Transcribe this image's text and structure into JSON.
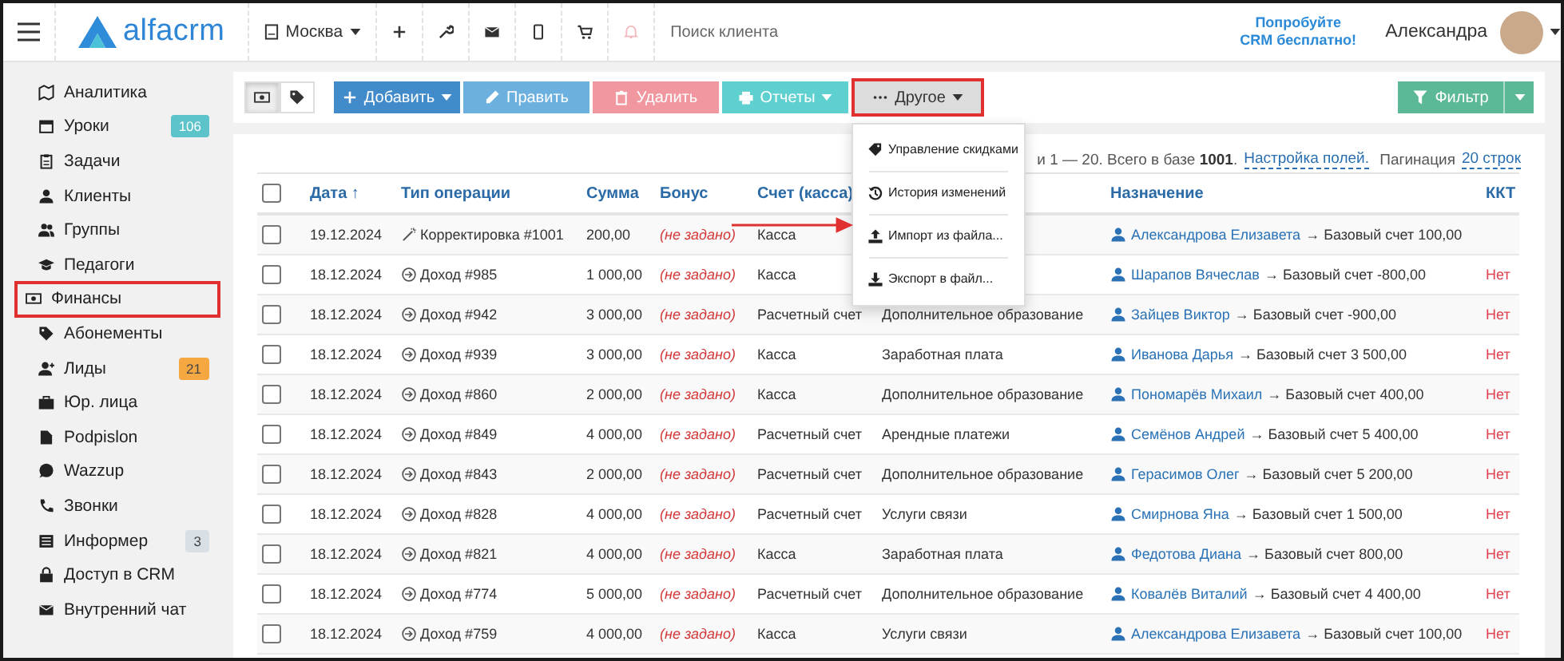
{
  "topbar": {
    "logo": "alfacrm",
    "branch": "Москва",
    "bell_active": false,
    "search": {
      "placeholder": "Поиск клиента"
    },
    "promo": [
      "Попробуйте",
      "CRM бесплатно!"
    ],
    "user": "Александра"
  },
  "sidebar": {
    "items": [
      {
        "label": "Аналитика",
        "kind": "analytics",
        "annotated": false
      },
      {
        "label": "Уроки",
        "kind": "lessons",
        "annotated": false,
        "badge": {
          "text": "106",
          "color": "#5bc3c9"
        }
      },
      {
        "label": "Задачи",
        "kind": "tasks",
        "annotated": false
      },
      {
        "label": "Клиенты",
        "kind": "clients",
        "annotated": false
      },
      {
        "label": "Группы",
        "kind": "groups",
        "annotated": false
      },
      {
        "label": "Педагоги",
        "kind": "teachers",
        "annotated": false
      },
      {
        "label": "Финансы",
        "kind": "finance",
        "annotated": true
      },
      {
        "label": "Абонементы",
        "kind": "tag",
        "annotated": false
      },
      {
        "label": "Лиды",
        "kind": "leads",
        "annotated": false,
        "badge": {
          "text": "21",
          "color": "#f5a742"
        }
      },
      {
        "label": "Юр. лица",
        "kind": "briefcase",
        "annotated": false
      },
      {
        "label": "Podpislon",
        "kind": "file",
        "annotated": false
      },
      {
        "label": "Wazzup",
        "kind": "chat",
        "annotated": false
      },
      {
        "label": "Звонки",
        "kind": "phone",
        "annotated": false
      },
      {
        "label": "Информер",
        "kind": "informer",
        "annotated": false,
        "badge": {
          "text": "3",
          "color": "#d8e0e6"
        }
      },
      {
        "label": "Доступ в CRM",
        "kind": "lock",
        "annotated": false
      },
      {
        "label": "Внутренний чат",
        "kind": "mail",
        "annotated": false
      }
    ]
  },
  "toolbar": {
    "views": [
      {
        "kind": "finance",
        "selected": true
      },
      {
        "kind": "tag",
        "selected": false
      }
    ],
    "buttons": [
      {
        "label": "Добавить",
        "kind": "add",
        "color": "#428bca",
        "caret": true,
        "annotated": false
      },
      {
        "label": "Править",
        "kind": "edit",
        "color": "#6cb0e0",
        "caret": false,
        "annotated": false
      },
      {
        "label": "Удалить",
        "kind": "delete",
        "color": "#f0979f",
        "caret": false,
        "annotated": false
      },
      {
        "label": "Отчеты",
        "kind": "reports",
        "color": "#5fd0d0",
        "caret": true,
        "annotated": false
      },
      {
        "label": "Другое",
        "kind": "other",
        "color": "#dcdcdc",
        "caret": true,
        "annotated": true
      }
    ],
    "menu": [
      {
        "label": "Управление скидками",
        "kind": "discount",
        "annotated": false
      },
      {
        "label": "История изменений",
        "kind": "history",
        "annotated": false
      },
      {
        "label": "Импорт из файла...",
        "kind": "upload",
        "annotated": true
      },
      {
        "label": "Экспорт в файл...",
        "kind": "download",
        "annotated": false
      }
    ],
    "filter": {
      "label": "Фильтр",
      "color": "#5cb996"
    }
  },
  "summary": {
    "text": "и 1 — 20. Всего в базе **1001**.",
    "fields_link": "Настройка полей.",
    "pagination_label": "Пагинация",
    "pagination_link": "20 строк"
  },
  "table": {
    "select_all_checked": false,
    "columns": [
      "Дата ↑",
      "Тип операции",
      "Сумма",
      "Бонус",
      "Счет (касса)",
      "Назначение",
      "ККТ"
    ],
    "rows": [
      {
        "checked": false,
        "date": "19.12.2024",
        "kind": "correction",
        "type": "Корректировка #1001",
        "sum": "200,00",
        "bonus": "(не задано)",
        "account": "Касса",
        "client": "Александрова Елизавета",
        "target": "→ Базовый счет 100,00"
      },
      {
        "checked": false,
        "date": "18.12.2024",
        "kind": "income",
        "type": "Доход #985",
        "sum": "1 000,00",
        "bonus": "(не задано)",
        "account": "Касса",
        "client": "Шарапов Вячеслав",
        "target": "→ Базовый счет -800,00",
        "kkt": "Нет"
      },
      {
        "checked": false,
        "date": "18.12.2024",
        "kind": "income",
        "type": "Доход #942",
        "sum": "3 000,00",
        "bonus": "(не задано)",
        "account": "Расчетный счет",
        "category": "Дополнительное образование",
        "client": "Зайцев Виктор",
        "target": "→ Базовый счет -900,00",
        "kkt": "Нет"
      },
      {
        "checked": false,
        "date": "18.12.2024",
        "kind": "income",
        "type": "Доход #939",
        "sum": "3 000,00",
        "bonus": "(не задано)",
        "account": "Касса",
        "category": "Заработная плата",
        "client": "Иванова Дарья",
        "target": "→ Базовый счет 3 500,00",
        "kkt": "Нет"
      },
      {
        "checked": false,
        "date": "18.12.2024",
        "kind": "income",
        "type": "Доход #860",
        "sum": "2 000,00",
        "bonus": "(не задано)",
        "account": "Касса",
        "category": "Дополнительное образование",
        "client": "Пономарёв Михаил",
        "target": "→ Базовый счет 400,00",
        "kkt": "Нет"
      },
      {
        "checked": false,
        "date": "18.12.2024",
        "kind": "income",
        "type": "Доход #849",
        "sum": "4 000,00",
        "bonus": "(не задано)",
        "account": "Расчетный счет",
        "category": "Арендные платежи",
        "client": "Семёнов Андрей",
        "target": "→ Базовый счет 5 400,00",
        "kkt": "Нет"
      },
      {
        "checked": false,
        "date": "18.12.2024",
        "kind": "income",
        "type": "Доход #843",
        "sum": "2 000,00",
        "bonus": "(не задано)",
        "account": "Расчетный счет",
        "category": "Дополнительное образование",
        "client": "Герасимов Олег",
        "target": "→ Базовый счет 5 200,00",
        "kkt": "Нет"
      },
      {
        "checked": false,
        "date": "18.12.2024",
        "kind": "income",
        "type": "Доход #828",
        "sum": "4 000,00",
        "bonus": "(не задано)",
        "account": "Расчетный счет",
        "category": "Услуги связи",
        "client": "Смирнова Яна",
        "target": "→ Базовый счет 1 500,00",
        "kkt": "Нет"
      },
      {
        "checked": false,
        "date": "18.12.2024",
        "kind": "income",
        "type": "Доход #821",
        "sum": "4 000,00",
        "bonus": "(не задано)",
        "account": "Касса",
        "category": "Заработная плата",
        "client": "Федотова Диана",
        "target": "→ Базовый счет 800,00",
        "kkt": "Нет"
      },
      {
        "checked": false,
        "date": "18.12.2024",
        "kind": "income",
        "type": "Доход #774",
        "sum": "5 000,00",
        "bonus": "(не задано)",
        "account": "Расчетный счет",
        "category": "Дополнительное образование",
        "client": "Ковалёв Виталий",
        "target": "→ Базовый счет 4 400,00",
        "kkt": "Нет"
      },
      {
        "checked": false,
        "date": "18.12.2024",
        "kind": "income",
        "type": "Доход #759",
        "sum": "4 000,00",
        "bonus": "(не задано)",
        "account": "Касса",
        "category": "Услуги связи",
        "client": "Александрова Елизавета",
        "target": "→ Базовый счет 100,00",
        "kkt": "Нет"
      }
    ]
  }
}
